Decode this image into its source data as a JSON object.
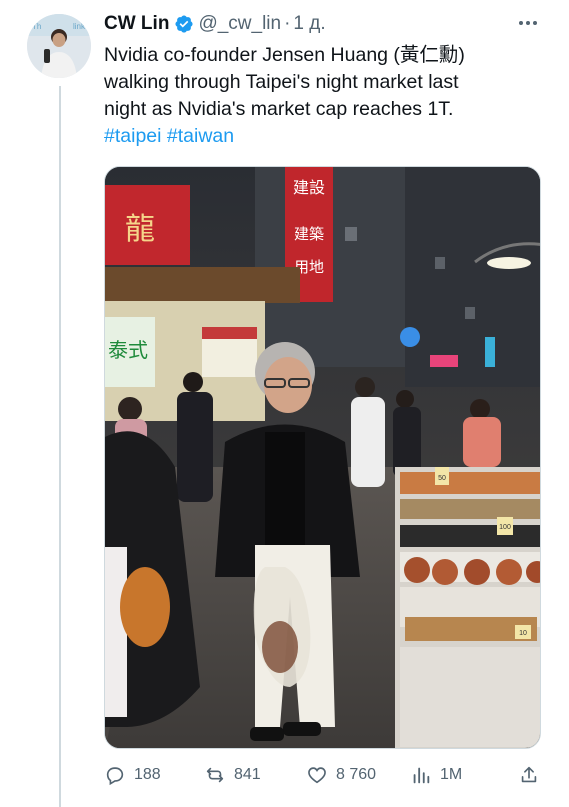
{
  "author": {
    "name": "CW Lin",
    "handle": "@_cw_lin",
    "separator": "·",
    "time": "1 д.",
    "verified": true,
    "verified_color": "#1d9bf0"
  },
  "tweet": {
    "lines": [
      "Nvidia co-founder Jensen Huang (黃仁勳)",
      "walking through Taipei's night market last",
      "night as Nvidia's market cap reaches 1T."
    ],
    "hashtags": [
      "#taipei",
      "#taiwan"
    ],
    "hashtag_separator": " "
  },
  "media": {
    "signs": {
      "top_red_sign": "建設 建築用地",
      "left_red_sign": "龍",
      "shop_sign": "泰式",
      "price_tags": [
        "50",
        "100",
        "10"
      ]
    }
  },
  "actions": {
    "replies": "188",
    "reposts": "841",
    "likes": "8 760",
    "views": "1M"
  },
  "colors": {
    "accent": "#1d9bf0",
    "text": "#0f1419",
    "muted": "#536471",
    "border": "#cfd9de"
  }
}
